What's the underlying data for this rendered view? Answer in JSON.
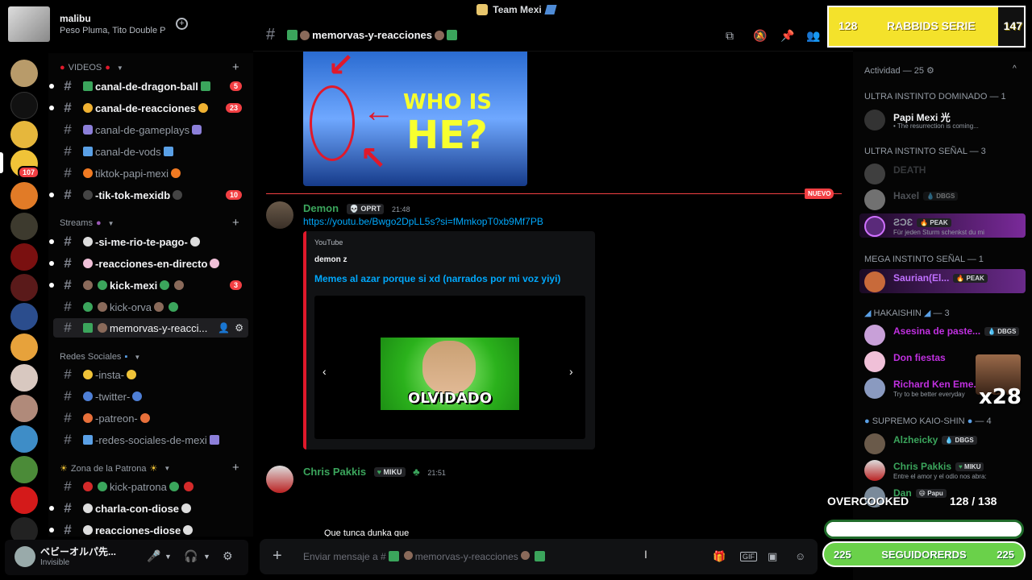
{
  "window": {
    "title": "Team Mexi"
  },
  "user_header": {
    "name": "malibu",
    "subtitle": "Peso Pluma, Tito Double P"
  },
  "servers": {
    "badge": "107"
  },
  "channels": {
    "cat_videos": "VIDEOS",
    "cat_streams": "Streams",
    "cat_redes": "Redes Sociales",
    "cat_patrona": "Zona de la Patrona",
    "items": [
      {
        "label": "canal-de-dragon-ball",
        "badge": "5"
      },
      {
        "label": "canal-de-reacciones",
        "badge": "23"
      },
      {
        "label": "canal-de-gameplays"
      },
      {
        "label": "canal-de-vods"
      },
      {
        "label": "tiktok-papi-mexi"
      },
      {
        "label": "-tik-tok-mexidb",
        "badge": "10"
      },
      {
        "label": "-si-me-rio-te-pago-"
      },
      {
        "label": "-reacciones-en-directo"
      },
      {
        "label": "kick-mexi",
        "badge": "3"
      },
      {
        "label": "kick-orva"
      },
      {
        "label": "memorvas-y-reacci..."
      },
      {
        "label": "-insta-"
      },
      {
        "label": "-twitter-"
      },
      {
        "label": "-patreon-"
      },
      {
        "label": "-redes-sociales-de-mexi"
      },
      {
        "label": "kick-patrona"
      },
      {
        "label": "charla-con-diose"
      },
      {
        "label": "reacciones-diose"
      }
    ]
  },
  "user_panel": {
    "name": "ベビーオルパ先...",
    "status": "Invisible"
  },
  "channel_header": {
    "title": "memorvas-y-reacciones"
  },
  "messages": {
    "thumb_text_1": "WHO IS",
    "thumb_text_2": "HE?",
    "new_label": "NUEVO",
    "demon": {
      "author": "Demon",
      "tag": "OPRT",
      "time": "21:48",
      "link": "https://youtu.be/Bwgo2DpLL5s?si=fMmkopT0xb9Mf7PB",
      "embed_provider": "YouTube",
      "embed_author": "demon z",
      "embed_title": "Memes al azar porque si xd (narrados por mi voz yiyi)",
      "embed_thumb_text": "OLVIDADO"
    },
    "chris": {
      "author": "Chris Pakkis",
      "tag": "MIKU",
      "time": "21:51",
      "caption": "Que tunca dunka que"
    }
  },
  "composer": {
    "placeholder": "Enviar mensaje a #",
    "channel": "memorvas-y-reacciones"
  },
  "members": {
    "activity_header": "Actividad — 25",
    "categories": {
      "c1": "ULTRA INSTINTO DOMINADO — 1",
      "c2": "ULTRA INSTINTO SEÑAL — 3",
      "c3": "MEGA INSTINTO SEÑAL — 1",
      "c4": "HAKAISHIN",
      "c4_count": "— 3",
      "c5": "SUPREMO KAIO-SHIN",
      "c5_count": "— 4"
    },
    "list": [
      {
        "name": "Papi Mexi 光",
        "activity": "• The resurrection is coming..."
      },
      {
        "name": "DEATH"
      },
      {
        "name": "Haxel",
        "tag": "DBGS"
      },
      {
        "name": "ƧƆƐ",
        "tag": "PEAK",
        "activity": "Für jeden Sturm schenkst du mi"
      },
      {
        "name": "Saurian(El...",
        "tag": "PEAK"
      },
      {
        "name": "Asesina de paste...",
        "tag": "DBGS"
      },
      {
        "name": "Don fiestas"
      },
      {
        "name": "Richard Ken Eme...",
        "activity": "Try to be better everyday"
      },
      {
        "name": "Alzheicky",
        "tag": "DBGS"
      },
      {
        "name": "Chris Pakkis",
        "tag": "MIKU",
        "activity": "Entre el amor y el odio nos abra:"
      },
      {
        "name": "Dan",
        "tag": "Papu"
      }
    ]
  },
  "overlays": {
    "rabbids_left": "128",
    "rabbids_title": "RABBIDS SERIE",
    "rabbids_right": "147",
    "multiplier": "x28",
    "overcooked": "OVERCOOKED",
    "counter": "128 / 138",
    "seg_left": "225",
    "seg_title": "SEGUIDORERDS",
    "seg_right": "225",
    "progress_fraction": 0.96
  },
  "colors": {
    "accent_red": "#f23f43",
    "link": "#00a8fc",
    "online": "#23a55a",
    "overlay_green": "#6ad14a",
    "overlay_yellow": "#f4e22b"
  }
}
